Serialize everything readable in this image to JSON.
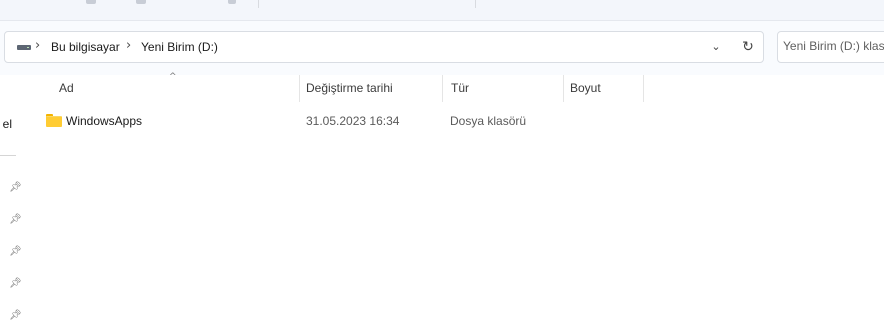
{
  "toolbar": {},
  "address_bar": {
    "location_icon": "drive-icon",
    "breadcrumbs": [
      {
        "label": "Bu bilgisayar"
      },
      {
        "label": "Yeni Birim (D:)"
      }
    ],
    "separator_icon": "chevron-right-icon",
    "dropdown_icon": "chevron-down-icon",
    "refresh_icon": "refresh-icon"
  },
  "search": {
    "placeholder": "Yeni Birim (D:) klasöründe ara"
  },
  "nav_pane": {
    "partial_label": "el",
    "pin_icon": "pin-icon"
  },
  "columns": {
    "name": "Ad",
    "modified": "Değiştirme tarihi",
    "type": "Tür",
    "size": "Boyut",
    "sort_icon": "sort-up-icon"
  },
  "files": [
    {
      "icon": "folder-icon",
      "name": "WindowsApps",
      "modified": "31.05.2023 16:34",
      "type": "Dosya klasörü",
      "size": ""
    }
  ],
  "colors": {
    "folder": "#ffcc33",
    "toolbar_bg": "#f3f6fb"
  }
}
